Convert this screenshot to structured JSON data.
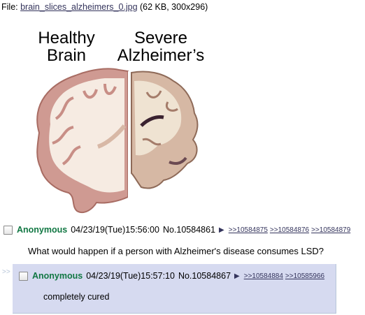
{
  "file": {
    "prefix": "File: ",
    "filename": "brain_slices_alzheimers_0.jpg",
    "info": " (62 KB, 300x296)"
  },
  "image": {
    "label_left_1": "Healthy",
    "label_left_2": "Brain",
    "label_right_1": "Severe",
    "label_right_2": "Alzheimer’s"
  },
  "post1": {
    "name": "Anonymous",
    "datetime": "04/23/19(Tue)15:56:00",
    "number": "No.10584861",
    "backlinks": [
      ">>10584875",
      ">>10584876",
      ">>10584879"
    ],
    "message": "What would happen if a person with Alzheimer's disease consumes LSD?"
  },
  "reply1": {
    "side_marker": ">>",
    "name": "Anonymous",
    "datetime": "04/23/19(Tue)15:57:10",
    "number": "No.10584867",
    "backlinks": [
      ">>10584884",
      ">>10585966"
    ],
    "message": "completely cured"
  },
  "colors": {
    "name_green": "#117743",
    "link": "#34345c",
    "reply_bg": "#d6daf0",
    "reply_border": "#b7c5d9"
  }
}
